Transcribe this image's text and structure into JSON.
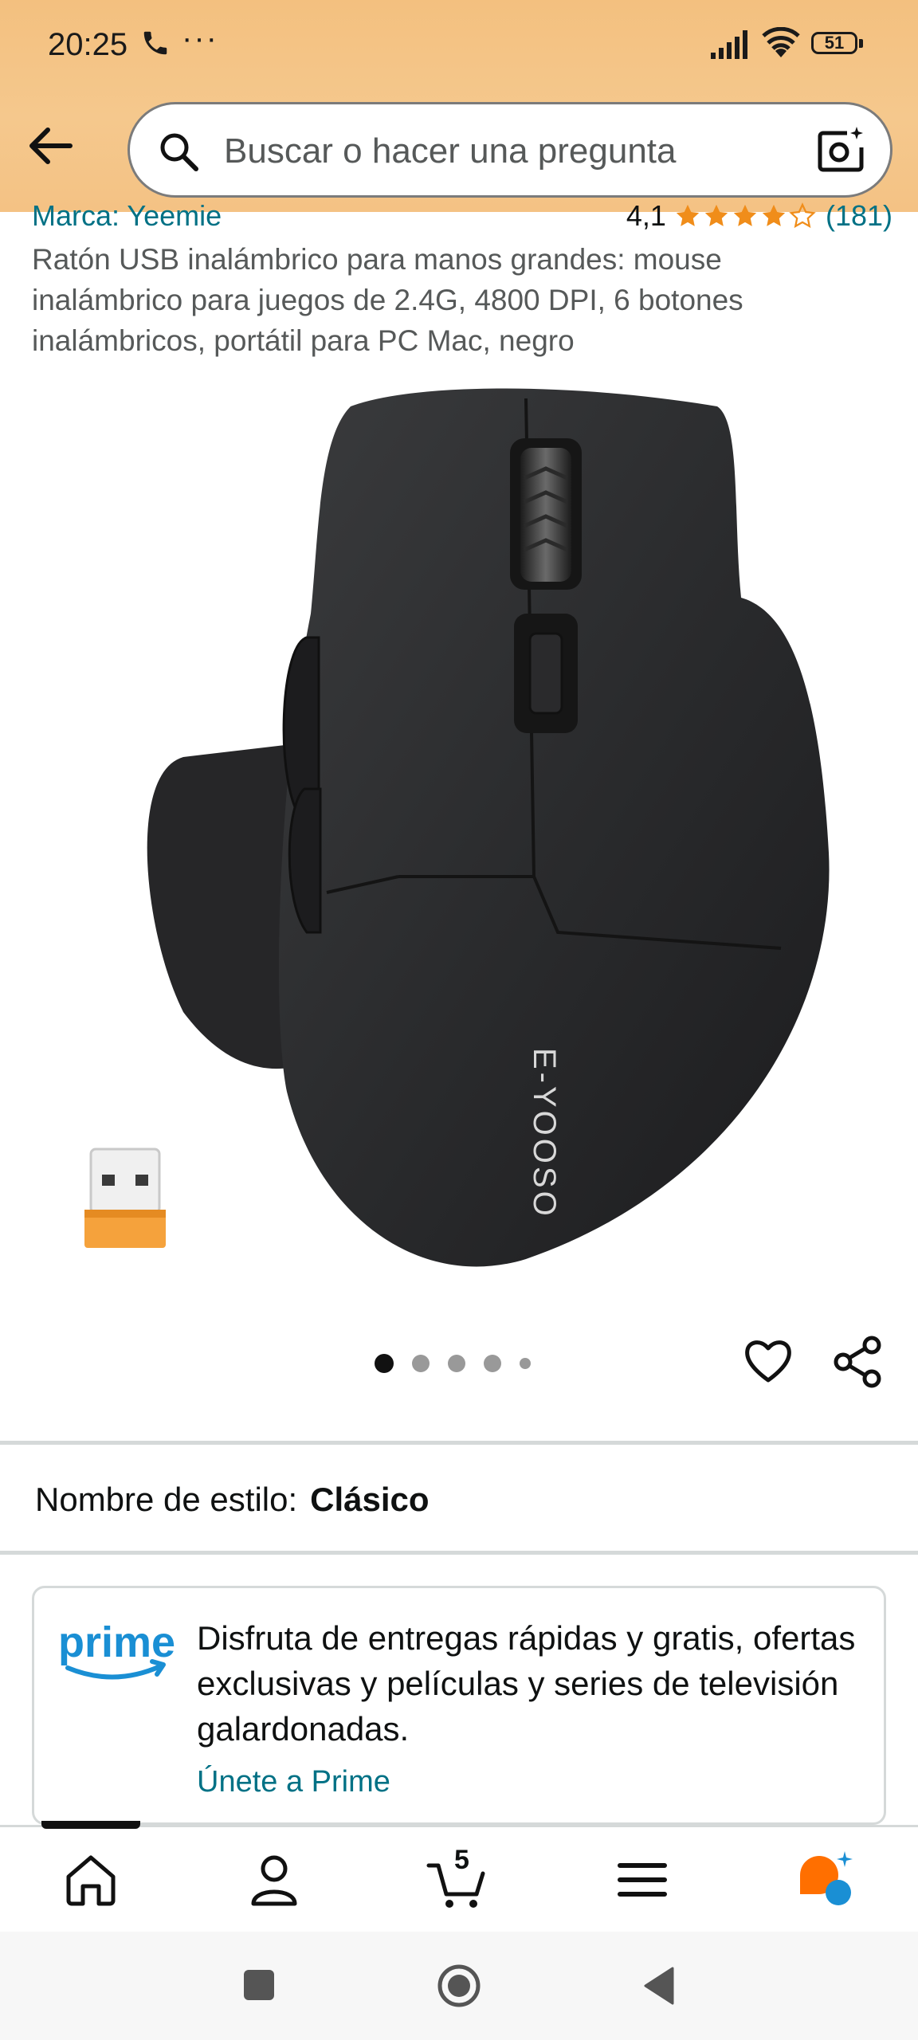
{
  "status_bar": {
    "time": "20:25",
    "dots": "···",
    "battery": "51"
  },
  "header": {
    "search_placeholder": "Buscar o hacer una pregunta"
  },
  "product": {
    "brand": "Marca: Yeemie",
    "rating": "4,1",
    "stars": 4,
    "rating_count": "(181)",
    "title": "Ratón USB inalámbrico para manos grandes: mouse inalámbrico para juegos de 2.4G, 4800 DPI, 6 botones inalámbricos, portátil para PC Mac, negro",
    "image_brand_text": "E-YOOSO",
    "image_count": 5,
    "active_image": 1
  },
  "style": {
    "label": "Nombre de estilo:",
    "value": "Clásico"
  },
  "prime": {
    "logo_text": "prime",
    "description": "Disfruta de entregas rápidas y gratis, ofertas exclusivas y películas y series de televisión galardonadas.",
    "link": "Únete a Prime"
  },
  "bottom_nav": {
    "items": [
      {
        "name": "home",
        "icon": "home-icon"
      },
      {
        "name": "account",
        "icon": "person-icon"
      },
      {
        "name": "cart",
        "icon": "cart-icon",
        "count": "5"
      },
      {
        "name": "menu",
        "icon": "menu-icon"
      },
      {
        "name": "rufus",
        "icon": "rufus-assistant-icon"
      }
    ]
  },
  "colors": {
    "header_bg": "#f3c07f",
    "link": "#007185",
    "star": "#f08d1a",
    "prime_blue": "#1a8fd4",
    "rufus_orange": "#ff6f00"
  }
}
